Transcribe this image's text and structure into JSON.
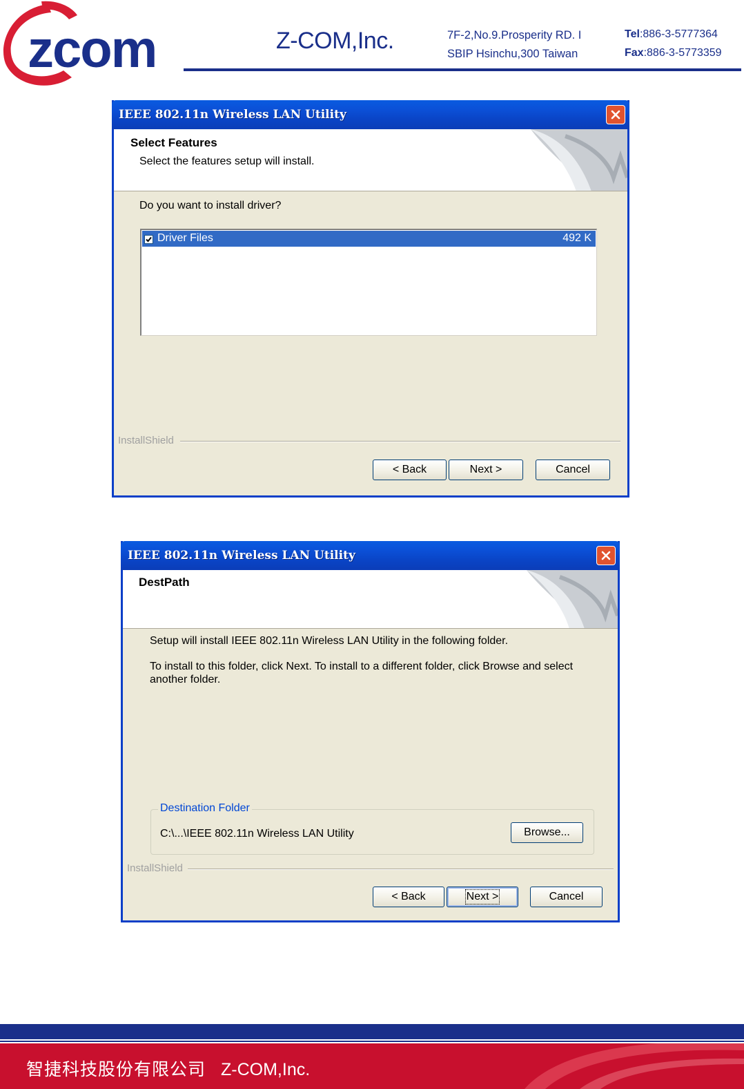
{
  "header": {
    "logo_text": "zcom",
    "company": "Z-COM,Inc.",
    "address_line1": "7F-2,No.9.Prosperity RD. I",
    "address_line2": "SBIP Hsinchu,300 Taiwan",
    "tel_label": "Tel",
    "tel_value": ":886-3-5777364",
    "fax_label": "Fax",
    "fax_value": ":886-3-5773359"
  },
  "dialog1": {
    "title": "IEEE 802.11n Wireless LAN Utility",
    "banner_title": "Select Features",
    "banner_subtitle": "Select the features setup will install.",
    "question": "Do you want to install driver?",
    "features": [
      {
        "label": "Driver Files",
        "size": "492 K",
        "checked": true
      }
    ],
    "brand": "InstallShield",
    "back_label": "< Back",
    "next_label": "Next >",
    "cancel_label": "Cancel"
  },
  "dialog2": {
    "title": "IEEE 802.11n Wireless LAN Utility",
    "banner_title": "DestPath",
    "line1": "Setup will install IEEE 802.11n Wireless LAN Utility in the following folder.",
    "line2": "To install to this folder, click Next. To install to a different folder, click Browse and select another folder.",
    "group_label": "Destination Folder",
    "path": "C:\\...\\IEEE 802.11n Wireless LAN Utility",
    "browse_label": "Browse...",
    "brand": "InstallShield",
    "back_label": "< Back",
    "next_label": "Next >",
    "cancel_label": "Cancel"
  },
  "footer": {
    "chinese_name": "智捷科技股份有限公司",
    "company": "Z-COM,Inc."
  },
  "colors": {
    "brand_blue": "#1a2f8a",
    "brand_red": "#c8102e",
    "xp_title_blue": "#0a4fd6",
    "selection_blue": "#316ac5"
  }
}
